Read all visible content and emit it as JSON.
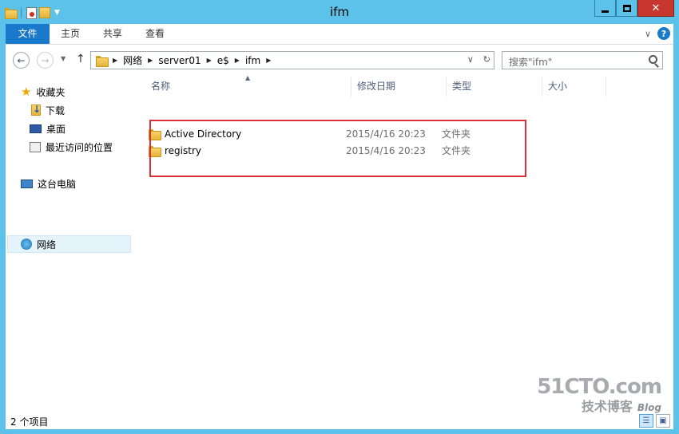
{
  "window": {
    "title": "ifm",
    "close_glyph": "✕"
  },
  "ribbon": {
    "tabs": [
      "文件",
      "主页",
      "共享",
      "查看"
    ],
    "help": "?"
  },
  "nav": {
    "breadcrumb": [
      "网络",
      "server01",
      "e$",
      "ifm"
    ],
    "search_placeholder": "搜索\"ifm\""
  },
  "sidebar": {
    "favorites": "收藏夹",
    "downloads": "下载",
    "desktop": "桌面",
    "recent": "最近访问的位置",
    "this_pc": "这台电脑",
    "network": "网络"
  },
  "columns": {
    "name": "名称",
    "date": "修改日期",
    "type": "类型",
    "size": "大小"
  },
  "files": [
    {
      "name": "Active Directory",
      "date": "2015/4/16 20:23",
      "type": "文件夹"
    },
    {
      "name": "registry",
      "date": "2015/4/16 20:23",
      "type": "文件夹"
    }
  ],
  "status": {
    "item_count": "2 个项目"
  },
  "watermark": {
    "site": "51CTO.com",
    "sub": "技术博客",
    "blog": "Blog"
  },
  "colors": {
    "frame": "#5cc2ea",
    "file_tab": "#1979ca",
    "close": "#c7372f",
    "highlight": "#d9303a"
  }
}
